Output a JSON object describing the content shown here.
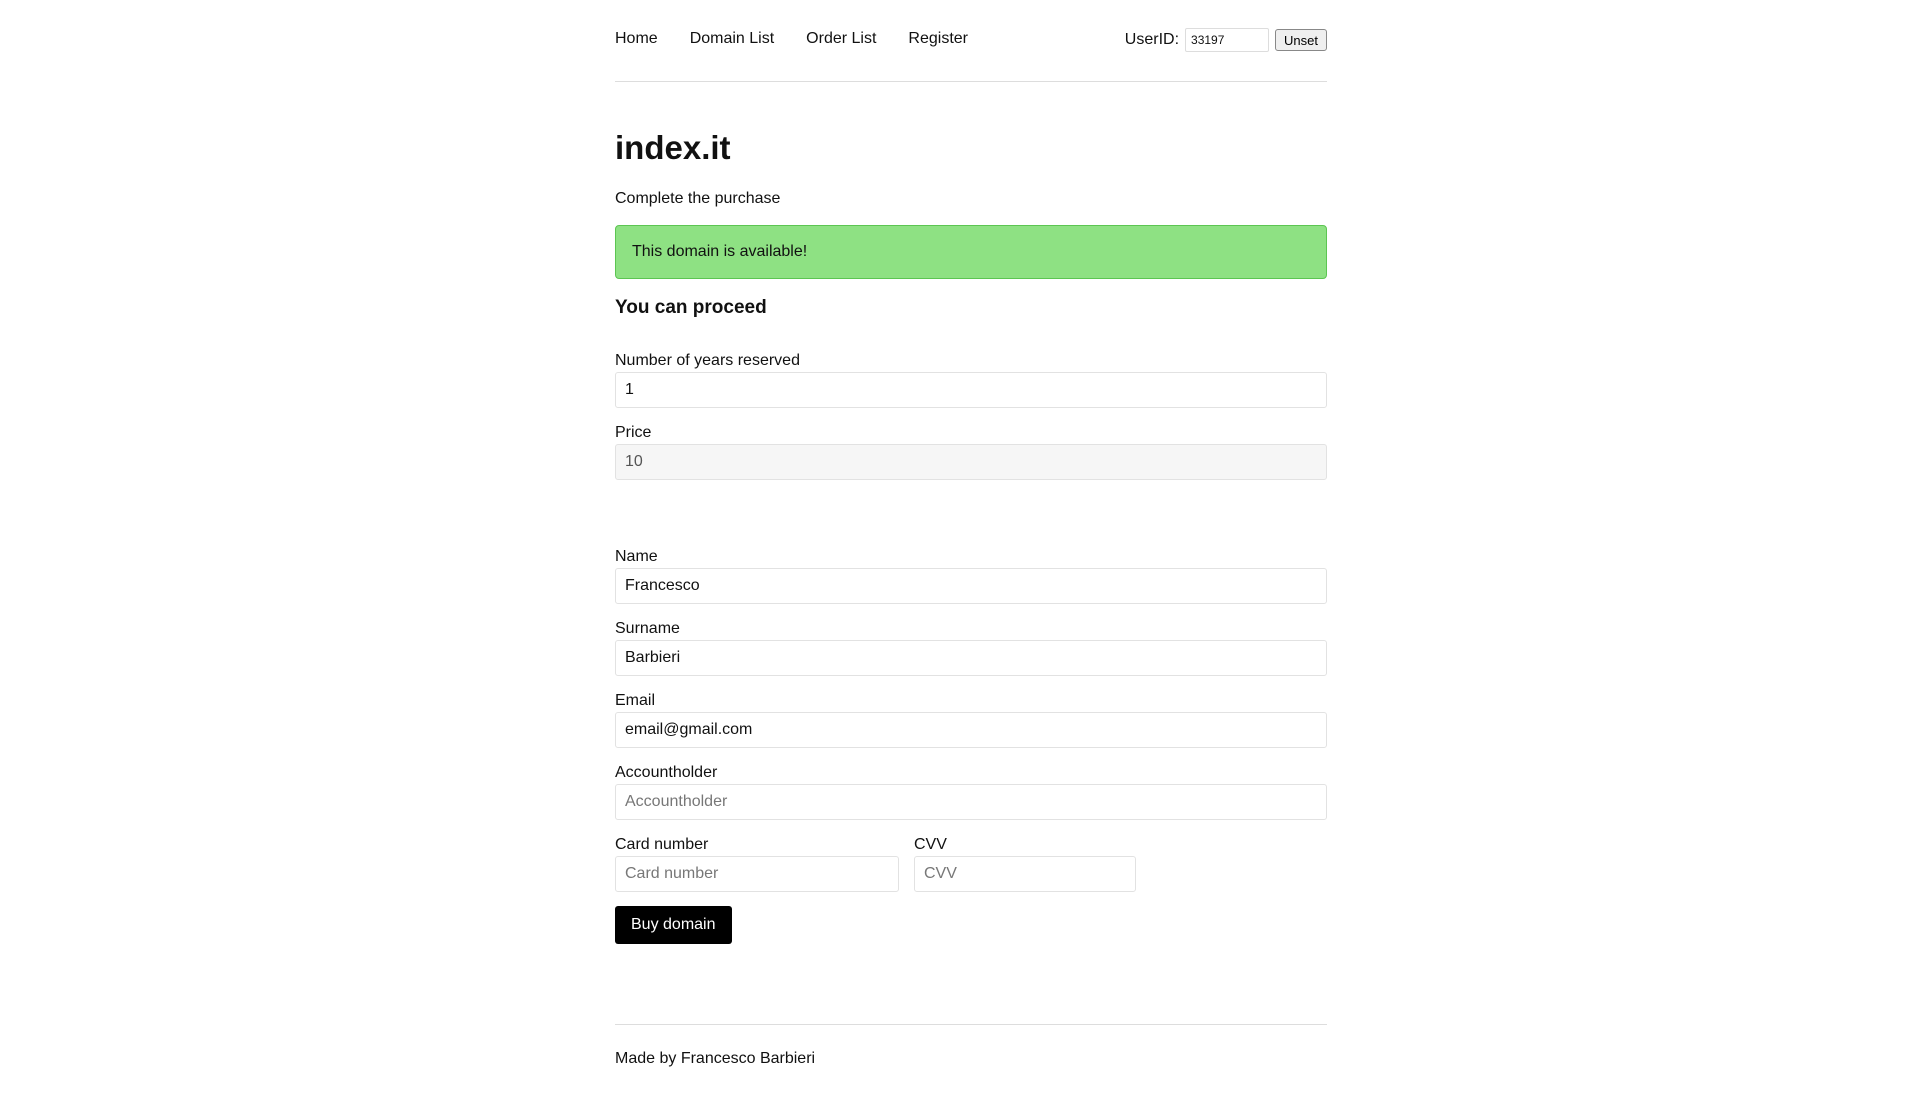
{
  "nav": {
    "links": [
      "Home",
      "Domain List",
      "Order List",
      "Register"
    ],
    "user_label": "UserID:",
    "user_id": "33197",
    "unset_label": "Unset"
  },
  "page": {
    "title": "index.it",
    "subtitle": "Complete the purchase",
    "alert": "This domain is available!",
    "alert_color": "#8ee183",
    "proceed": "You can proceed"
  },
  "form": {
    "years": {
      "label": "Number of years reserved",
      "value": "1"
    },
    "price": {
      "label": "Price",
      "value": "10"
    },
    "name": {
      "label": "Name",
      "value": "Francesco"
    },
    "surname": {
      "label": "Surname",
      "value": "Barbieri"
    },
    "email": {
      "label": "Email",
      "value": "email@gmail.com"
    },
    "accountholder": {
      "label": "Accountholder",
      "placeholder": "Accountholder"
    },
    "card_number": {
      "label": "Card number",
      "placeholder": "Card number"
    },
    "cvv": {
      "label": "CVV",
      "placeholder": "CVV"
    },
    "submit_label": "Buy domain"
  },
  "footer": {
    "text": "Made by Francesco Barbieri"
  }
}
